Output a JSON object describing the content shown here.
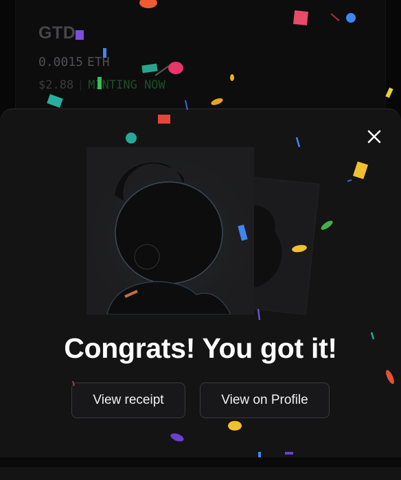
{
  "background_card": {
    "title": "GTD",
    "price": "0.0015",
    "unit": "ETH",
    "usd": "$2.88",
    "status": "MINTING NOW"
  },
  "modal": {
    "headline": "Congrats! You got it!",
    "buttons": {
      "receipt": "View receipt",
      "profile": "View on Profile"
    },
    "close_icon": "close-icon"
  },
  "colors": {
    "modal_bg": "#141415",
    "status_green": "#2f7a3a",
    "text_primary": "#ffffff"
  }
}
